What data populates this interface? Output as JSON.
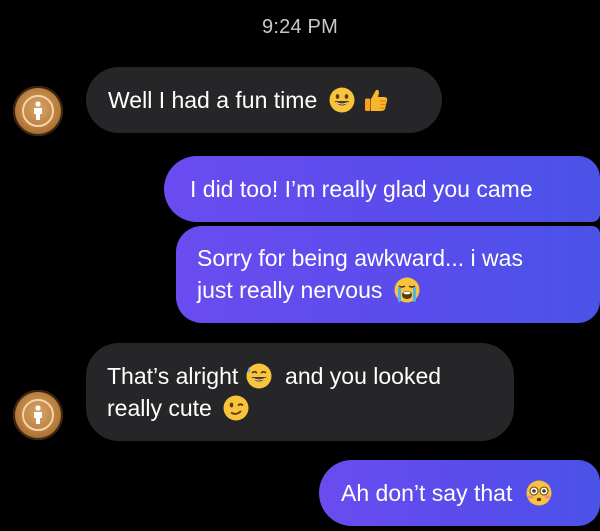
{
  "timestamp": "9:24 PM",
  "messages": [
    {
      "direction": "incoming",
      "text": "Well I had a fun time",
      "emoji": [
        "grinning-face-icon",
        "thumbs-up-icon"
      ]
    },
    {
      "direction": "outgoing",
      "text": "I did too! I’m really glad you came"
    },
    {
      "direction": "outgoing",
      "line1": "Sorry for being awkward... i was",
      "line2": "just really nervous",
      "emoji": [
        "loudly-crying-face-icon"
      ]
    },
    {
      "direction": "incoming",
      "line1a": "That’s alright",
      "line1b": "and you looked",
      "line2": "really cute",
      "emoji": [
        "grinning-sweat-icon",
        "winking-face-icon"
      ]
    },
    {
      "direction": "outgoing",
      "text": "Ah don’t say that",
      "emoji": [
        "flushed-face-icon"
      ]
    }
  ],
  "colors": {
    "background": "#000000",
    "incoming_bubble": "#262629",
    "outgoing_bubble_start": "#6a4cf0",
    "outgoing_bubble_end": "#4a53e8",
    "timestamp_text": "#c9c9cc"
  }
}
